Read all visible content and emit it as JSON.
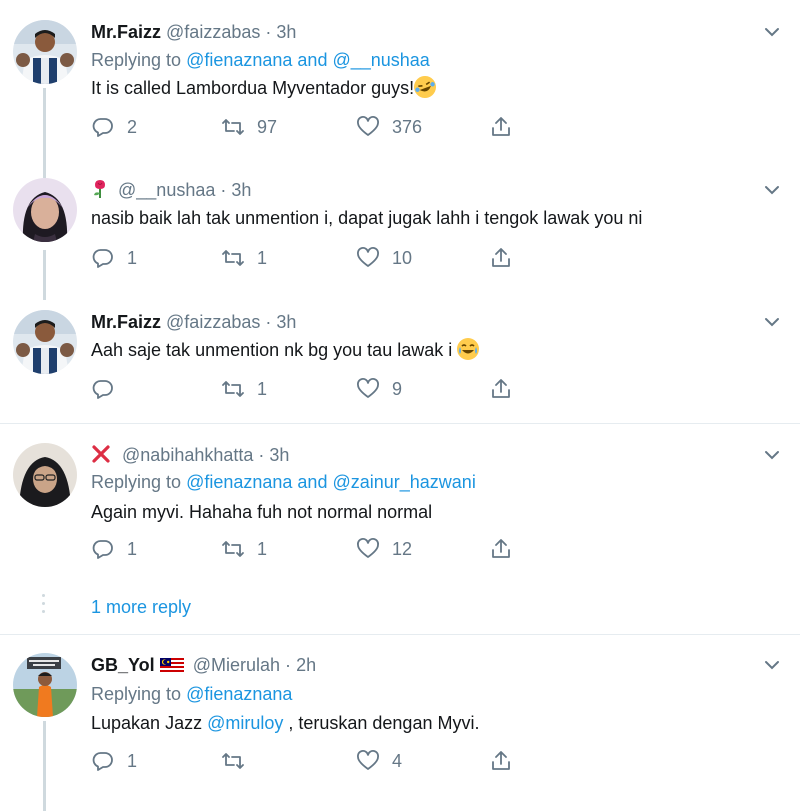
{
  "tweets": [
    {
      "name": "Mr.Faizz",
      "handle": "@faizzabas",
      "time": "3h",
      "reply_prefix": "Replying to ",
      "reply_mentions": [
        "@fienaznana",
        "@__nushaa"
      ],
      "reply_joiner": " and ",
      "text": "It is called Lambordua Myventador guys!",
      "emoji": "rofl-emoji",
      "replies": "2",
      "retweets": "97",
      "likes": "376"
    },
    {
      "handle": "@__nushaa",
      "time": "3h",
      "badge": "rose-icon",
      "text": "nasib baik lah tak unmention i, dapat jugak lahh i tengok lawak you ni",
      "replies": "1",
      "retweets": "1",
      "likes": "10"
    },
    {
      "name": "Mr.Faizz",
      "handle": "@faizzabas",
      "time": "3h",
      "text": "Aah saje tak unmention nk bg you tau lawak i",
      "emoji": "tears-of-joy-emoji",
      "replies": "",
      "retweets": "1",
      "likes": "9"
    },
    {
      "handle": "@nabihahkhatta",
      "time": "3h",
      "badge": "cross-mark-icon",
      "reply_prefix": "Replying to ",
      "reply_mentions": [
        "@fienaznana",
        "@zainur_hazwani"
      ],
      "reply_joiner": " and ",
      "text": "Again myvi. Hahaha fuh not normal normal",
      "replies": "1",
      "retweets": "1",
      "likes": "12"
    },
    {
      "name": "GB_Yol",
      "handle": "@Mierulah",
      "time": "2h",
      "badge": "malaysia-flag-icon",
      "reply_prefix": "Replying to ",
      "reply_mentions": [
        "@fienaznana"
      ],
      "text_before": "Lupakan Jazz ",
      "text_mention": "@miruloy",
      "text_after": " , teruskan dengan Myvi.",
      "replies": "1",
      "retweets": "",
      "likes": "4"
    }
  ],
  "more_reply": "1 more reply",
  "colors": {
    "accent": "#1b95e0",
    "muted": "#657786",
    "line": "#cfd9de",
    "divider": "#e6ecf0"
  }
}
